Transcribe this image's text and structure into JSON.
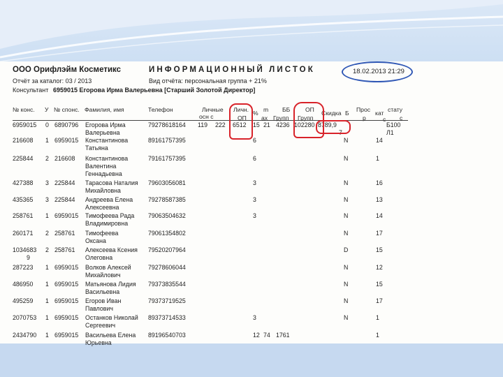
{
  "header": {
    "company": "ООО Орифлэйм Косметикс",
    "title": "ИНФОРМАЦИОННЫЙ ЛИСТОК",
    "date": "18.02.2013 21:29",
    "catalog_line": "Отчёт за каталог: 03 / 2013",
    "report_type": "Вид отчёта: персональная группа + 21%",
    "consultant_label": "Консультант",
    "consultant": "6959015 Егорова Ирма Валерьевна [Старший Золотой Директор]"
  },
  "columns": {
    "no": "№ конс.",
    "level": "У",
    "sponsor": "№ спонс.",
    "name": "Фамилия, имя",
    "phone": "Телефон",
    "personal_a": "Личные",
    "personal_b": "осн      с",
    "lop_a": "Личн.",
    "lop_b": "ОП",
    "pct": "%",
    "m_a": "m",
    "m_b": "ах",
    "bb_a": "ББ",
    "bb_b": "Групп",
    "op_a": "ОП",
    "op_b": "Групп",
    "discount": "Скидка",
    "b": "Б",
    "pros_a": "Прос",
    "pros_b": "р",
    "kat_a": "кат",
    "kat_b": "с",
    "status_a": "стату",
    "status_b": "с"
  },
  "rows": [
    {
      "no": "6959015",
      "level": "0",
      "sponsor": "6890796",
      "name1": "Егорова Ирма",
      "name2": "Валерьевна",
      "phone": "79278618164",
      "v1": "119",
      "v2": "222",
      "lop": "6512",
      "pct": "15",
      "max": "21",
      "bb": "4236",
      "op": "102280",
      "disc": "8789,9",
      "b": "",
      "disc2": "7",
      "n": "",
      "kat": "Б100",
      "kat2": "Л1"
    },
    {
      "no": "216608",
      "level": "1",
      "sponsor": "6959015",
      "name1": "Константинова",
      "name2": "Татьяна",
      "phone": "89161757395",
      "v1": "",
      "v2": "",
      "lop": "",
      "pct": "6",
      "max": "",
      "bb": "",
      "op": "",
      "disc": "",
      "b": "",
      "disc2": "",
      "n": "N",
      "kat": "14",
      "kat2": ""
    },
    {
      "no": "225844",
      "level": "2",
      "sponsor": "216608",
      "name1": "Константинова",
      "name2": "Валентина",
      "name3": "Геннадьевна",
      "phone": "79161757395",
      "v1": "",
      "v2": "",
      "lop": "",
      "pct": "6",
      "max": "",
      "bb": "",
      "op": "",
      "disc": "",
      "b": "",
      "disc2": "",
      "n": "N",
      "kat": "1",
      "kat2": ""
    },
    {
      "no": "427388",
      "level": "3",
      "sponsor": "225844",
      "name1": "Тарасова Наталия",
      "name2": "Михайловна",
      "phone": "79603056081",
      "v1": "",
      "v2": "",
      "lop": "",
      "pct": "3",
      "max": "",
      "bb": "",
      "op": "",
      "disc": "",
      "b": "",
      "disc2": "",
      "n": "N",
      "kat": "16",
      "kat2": ""
    },
    {
      "no": "435365",
      "level": "3",
      "sponsor": "225844",
      "name1": "Андреева Елена",
      "name2": "Алексеевна",
      "phone": "79278587385",
      "v1": "",
      "v2": "",
      "lop": "",
      "pct": "3",
      "max": "",
      "bb": "",
      "op": "",
      "disc": "",
      "b": "",
      "disc2": "",
      "n": "N",
      "kat": "13",
      "kat2": ""
    },
    {
      "no": "258761",
      "level": "1",
      "sponsor": "6959015",
      "name1": "Тимофеева Рада",
      "name2": "Владимировна",
      "phone": "79063504632",
      "v1": "",
      "v2": "",
      "lop": "",
      "pct": "3",
      "max": "",
      "bb": "",
      "op": "",
      "disc": "",
      "b": "",
      "disc2": "",
      "n": "N",
      "kat": "14",
      "kat2": ""
    },
    {
      "no": "260171",
      "level": "2",
      "sponsor": "258761",
      "name1": "Тимофеева",
      "name2": "Оксана",
      "phone": "79061354802",
      "v1": "",
      "v2": "",
      "lop": "",
      "pct": "",
      "max": "",
      "bb": "",
      "op": "",
      "disc": "",
      "b": "",
      "disc2": "",
      "n": "N",
      "kat": "17",
      "kat2": ""
    },
    {
      "no": "1034683",
      "no2": "9",
      "level": "2",
      "sponsor": "258761",
      "name1": "Алексеева Ксения",
      "name2": "Олеговна",
      "phone": "79520207964",
      "v1": "",
      "v2": "",
      "lop": "",
      "pct": "",
      "max": "",
      "bb": "",
      "op": "",
      "disc": "",
      "b": "",
      "disc2": "",
      "n": "D",
      "kat": "15",
      "kat2": ""
    },
    {
      "no": "287223",
      "level": "1",
      "sponsor": "6959015",
      "name1": "Волков Алексей",
      "name2": "Михайлович",
      "phone": "79278606044",
      "v1": "",
      "v2": "",
      "lop": "",
      "pct": "",
      "max": "",
      "bb": "",
      "op": "",
      "disc": "",
      "b": "",
      "disc2": "",
      "n": "N",
      "kat": "12",
      "kat2": ""
    },
    {
      "no": "486950",
      "level": "1",
      "sponsor": "6959015",
      "name1": "Матьянова Лидия",
      "name2": "Васильевна",
      "phone": "79373835544",
      "v1": "",
      "v2": "",
      "lop": "",
      "pct": "",
      "max": "",
      "bb": "",
      "op": "",
      "disc": "",
      "b": "",
      "disc2": "",
      "n": "N",
      "kat": "15",
      "kat2": ""
    },
    {
      "no": "495259",
      "level": "1",
      "sponsor": "6959015",
      "name1": "Егоров Иван",
      "name2": "Павлович",
      "phone": "79373719525",
      "v1": "",
      "v2": "",
      "lop": "",
      "pct": "",
      "max": "",
      "bb": "",
      "op": "",
      "disc": "",
      "b": "",
      "disc2": "",
      "n": "N",
      "kat": "17",
      "kat2": ""
    },
    {
      "no": "2070753",
      "level": "1",
      "sponsor": "6959015",
      "name1": "Останков Николай",
      "name2": "Сергеевич",
      "phone": "89373714533",
      "v1": "",
      "v2": "",
      "lop": "",
      "pct": "3",
      "max": "",
      "bb": "",
      "op": "",
      "disc": "",
      "b": "",
      "disc2": "",
      "n": "N",
      "kat": "1",
      "kat2": ""
    },
    {
      "no": "2434790",
      "level": "1",
      "sponsor": "6959015",
      "name1": "Васильева Елена",
      "name2": "Юрьевна",
      "phone": "89196540703",
      "v1": "",
      "v2": "",
      "lop": "",
      "pct": "12",
      "max": "74",
      "bb": "1761",
      "op": "",
      "disc": "",
      "b": "",
      "disc2": "",
      "n": "",
      "kat": "1",
      "kat2": ""
    }
  ],
  "colors": {
    "background": "#c6d9f0",
    "sheet": "#fdfdfb",
    "red_mark": "#d8232a",
    "blue_mark": "#2f57b5"
  }
}
